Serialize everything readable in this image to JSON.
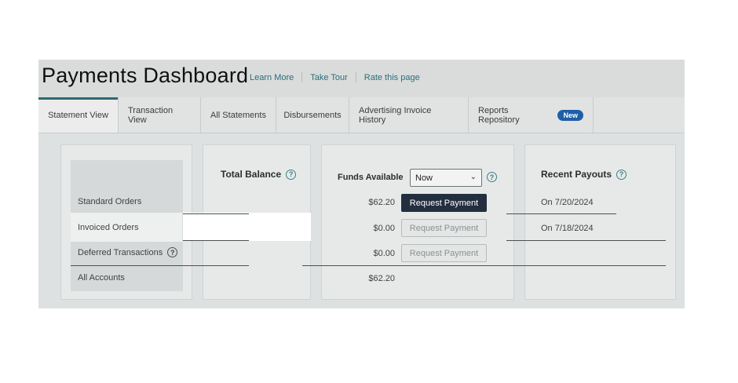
{
  "header": {
    "title": "Payments Dashboard",
    "links": [
      "Learn More",
      "Take Tour",
      "Rate this page"
    ]
  },
  "tabs": [
    {
      "label": "Statement View",
      "active": true
    },
    {
      "label": "Transaction View"
    },
    {
      "label": "All Statements"
    },
    {
      "label": "Disbursements"
    },
    {
      "label": "Advertising Invoice History"
    },
    {
      "label": "Reports Repository",
      "badge": "New"
    }
  ],
  "rows": {
    "labels": [
      "Standard Orders",
      "Invoiced Orders",
      "Deferred Transactions",
      "All Accounts"
    ]
  },
  "total_balance": {
    "title": "Total Balance"
  },
  "funds": {
    "title": "Funds Available",
    "select_value": "Now",
    "amounts": [
      "$62.20",
      "$0.00",
      "$0.00",
      "$62.20"
    ],
    "button_label": "Request Payment"
  },
  "payouts": {
    "title": "Recent Payouts",
    "items": [
      "On 7/20/2024",
      "On 7/18/2024"
    ]
  },
  "colors": {
    "accent": "#2b6971",
    "primary_button": "#232f3e",
    "badge": "#1e5fa8"
  }
}
